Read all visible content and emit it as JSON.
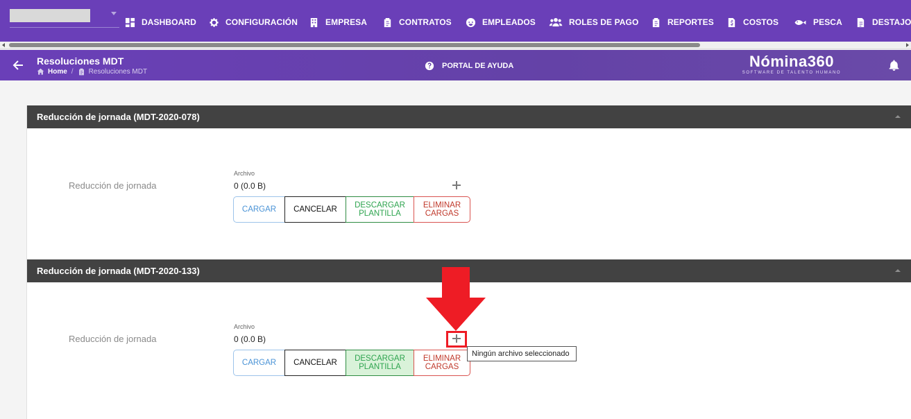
{
  "nav": {
    "items": [
      {
        "label": "DASHBOARD",
        "icon": "dashboard-icon"
      },
      {
        "label": "CONFIGURACIÓN",
        "icon": "gear-icon"
      },
      {
        "label": "EMPRESA",
        "icon": "building-icon"
      },
      {
        "label": "CONTRATOS",
        "icon": "clipboard-icon"
      },
      {
        "label": "EMPLEADOS",
        "icon": "face-icon"
      },
      {
        "label": "ROLES DE PAGO",
        "icon": "users-icon"
      },
      {
        "label": "REPORTES",
        "icon": "clipboard-icon"
      },
      {
        "label": "COSTOS",
        "icon": "invoice-icon"
      },
      {
        "label": "PESCA",
        "icon": "fish-icon"
      },
      {
        "label": "DESTAJO",
        "icon": "document-icon"
      }
    ]
  },
  "header": {
    "title": "Resoluciones MDT",
    "breadcrumb": {
      "home": "Home",
      "separator": "/",
      "current": "Resoluciones MDT"
    },
    "help_portal": "PORTAL DE AYUDA",
    "brand_name": "Nómina360",
    "brand_tagline": "SOFTWARE DE TALENTO HUMANO"
  },
  "panels": [
    {
      "title": "Reducción de jornada (MDT-2020-078)",
      "row_label": "Reducción de jornada",
      "file_label": "Archivo",
      "file_size": "0 (0.0 B)",
      "buttons": {
        "load": "CARGAR",
        "cancel": "CANCELAR",
        "download": "DESCARGAR PLANTILLA",
        "delete": "ELIMINAR CARGAS"
      }
    },
    {
      "title": "Reducción de jornada (MDT-2020-133)",
      "row_label": "Reducción de jornada",
      "file_label": "Archivo",
      "file_size": "0 (0.0 B)",
      "buttons": {
        "load": "CARGAR",
        "cancel": "CANCELAR",
        "download": "DESCARGAR PLANTILLA",
        "delete": "ELIMINAR CARGAS"
      }
    }
  ],
  "tooltip": "Ningún archivo seleccionado",
  "colors": {
    "primary": "#6a3fb8",
    "panel_header": "#424242",
    "annotation": "#ee1c25"
  }
}
